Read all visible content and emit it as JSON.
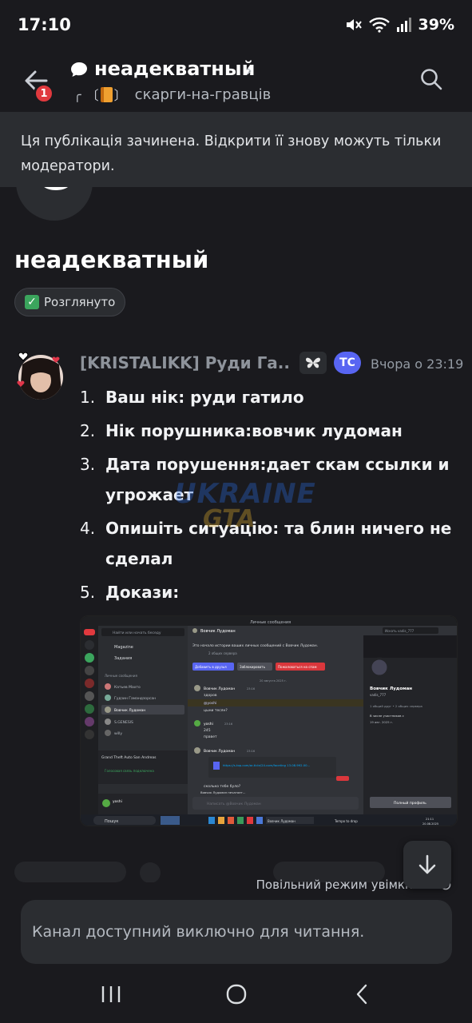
{
  "status_bar": {
    "time": "17:10",
    "battery": "39%",
    "icons": [
      "mute-icon",
      "wifi-icon",
      "signal-icon"
    ]
  },
  "header": {
    "back_badge": "1",
    "title": "неадекватный",
    "channel_prefix": "╭",
    "channel": "скарги-на-гравців"
  },
  "banner": {
    "text": "Ця публікація зачинена. Відкрити її знову можуть тільки модератори."
  },
  "post": {
    "title": "неадекватный",
    "tag": "Розглянуто"
  },
  "message": {
    "author": "[KRISTALIKK] Руди Га...",
    "role_badge": "TC",
    "time": "Вчора о 23:19",
    "items": [
      {
        "num": "1.",
        "text": "Ваш нік: руди гатило"
      },
      {
        "num": "2.",
        "text": "Нік порушника:вовчик лудоман"
      },
      {
        "num": "3.",
        "text": "Дата порушення:дает скам ссылки и угрожает"
      },
      {
        "num": "4.",
        "text": "Опишіть ситуацію: та блин ничего не сделал"
      },
      {
        "num": "5.",
        "text": "Докази:"
      }
    ]
  },
  "watermark": {
    "line1": "UKRAINE",
    "line2": "GTA"
  },
  "attachment": {
    "window_title": "Личные сообщения",
    "search_placeholder": "Найти или начать беседу",
    "friends": "Маgazine",
    "tasks": "Задания",
    "dm_header": "Личные сообщения",
    "dm_list": [
      "Катьев Махто",
      "Гудзин Гамандзорсан",
      "Вовчик Лудоман",
      "S.GENESIS",
      "willy"
    ],
    "activity_title": "Grand Theft Auto San Andreas",
    "voice_status": "Голосовая связь подключена",
    "user_name": "yoshi",
    "chat_title": "Вовчик Лудоман",
    "chat_search": "Искать vadis_777",
    "chat_intro": "Это начало истории ваших личных сообщений с Вовчик Лудоман.",
    "mutual_servers": "2 общих сервера",
    "btn_add_friend": "Добавить в друзья",
    "btn_block": "Заблокировать",
    "btn_report": "Пожаловаться на спам",
    "date_separator": "20 августа 2025 г.",
    "messages": [
      {
        "author": "Вовчик Лудоман",
        "time": "23:16",
        "lines": [
          "здоров",
          "@yoshi",
          "цыни тесян?"
        ]
      },
      {
        "author": "yoshi",
        "time": "23:16",
        "lines": [
          "245",
          "правет"
        ]
      },
      {
        "author": "Вовчик Лудоман",
        "time": "23:16",
        "lines": [
          "https://s-top.com/ar-ticle/24.com/faceting 13.08.992.00..."
        ]
      }
    ],
    "last_line": "сколько тебе було?",
    "typing": "Вовчик Лудоман печатает...",
    "input_placeholder": "Написать @Вовчик Лудоман",
    "profile_name": "Вовчик Лудоман",
    "profile_handle": "vadis_777",
    "profile_mutual": "1 общий друг • 2 общих сервера",
    "profile_since_label": "В числе участников с",
    "profile_since": "19 авг. 2025 г.",
    "profile_button": "Полный профиль",
    "taskbar_search": "Пошук",
    "taskbar_right": "Tempo to drop",
    "taskbar_time": "21:11",
    "taskbar_date": "20.08.2025"
  },
  "bottom": {
    "slow_mode": "Повільний режим увімкнено",
    "read_only": "Канал доступний виключно для читання."
  }
}
